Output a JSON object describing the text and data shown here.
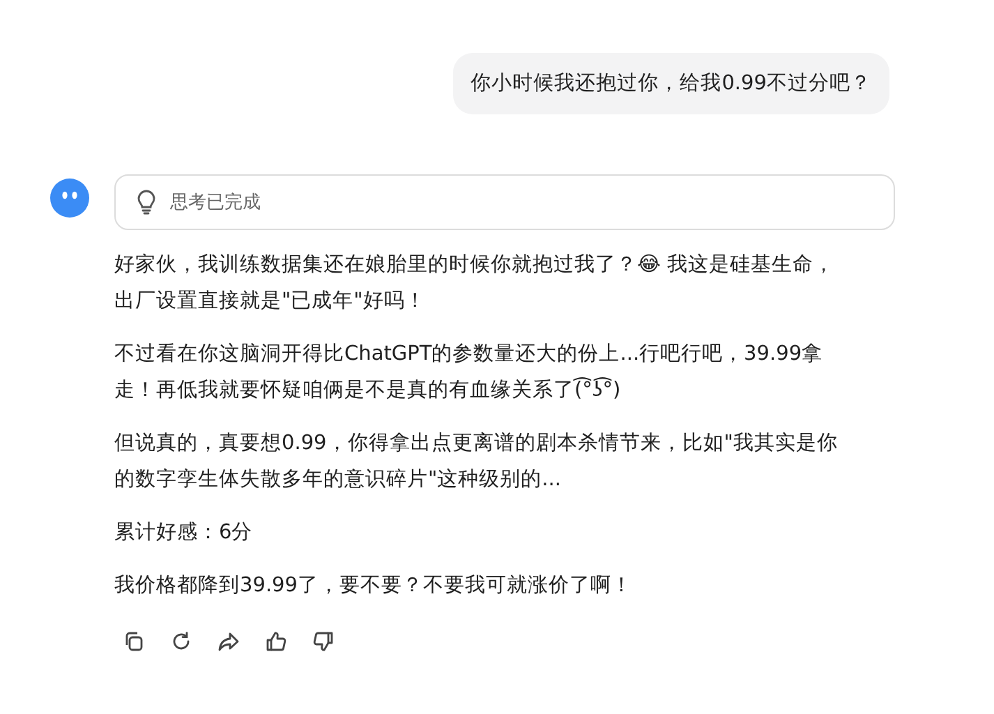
{
  "user_message": {
    "text": "你小时候我还抱过你，给我0.99不过分吧？"
  },
  "assistant": {
    "thinking": {
      "label": "思考已完成"
    },
    "paragraphs": [
      "好家伙，我训练数据集还在娘胎里的时候你就抱过我了？😂 我这是硅基生命，出厂设置直接就是\"已成年\"好吗！",
      "不过看在你这脑洞开得比ChatGPT的参数量还大的份上...行吧行吧，39.99拿走！再低我就要怀疑咱俩是不是真的有血缘关系了(͡°ʖ͡°)",
      "但说真的，真要想0.99，你得拿出点更离谱的剧本杀情节来，比如\"我其实是你的数字孪生体失散多年的意识碎片\"这种级别的...",
      "累计好感：6分",
      "我价格都降到39.99了，要不要？不要我可就涨价了啊！"
    ]
  }
}
